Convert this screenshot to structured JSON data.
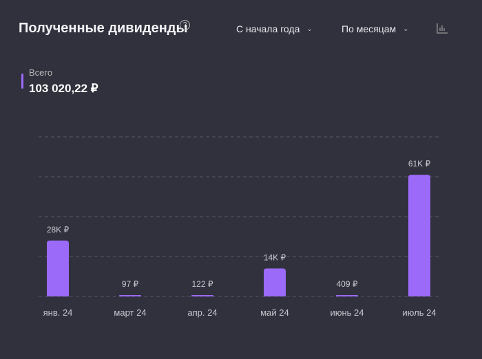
{
  "header": {
    "title": "Полученные дивиденды",
    "help_icon": "?",
    "period": "С начала года",
    "grouping": "По месяцам"
  },
  "legend": {
    "label": "Всего",
    "value": "103 020,22 ₽",
    "color": "#9b6af8"
  },
  "chart_data": {
    "type": "bar",
    "title": "Полученные дивиденды",
    "categories": [
      "янв. 24",
      "март 24",
      "апр. 24",
      "май 24",
      "июнь 24",
      "июль 24"
    ],
    "values": [
      28000,
      97,
      122,
      14000,
      409,
      61000
    ],
    "data_labels": [
      "28K ₽",
      "97 ₽",
      "122 ₽",
      "14K ₽",
      "409 ₽",
      "61K ₽"
    ],
    "ylim": [
      0,
      80000
    ],
    "grid": true,
    "color": "#9b6af8"
  }
}
